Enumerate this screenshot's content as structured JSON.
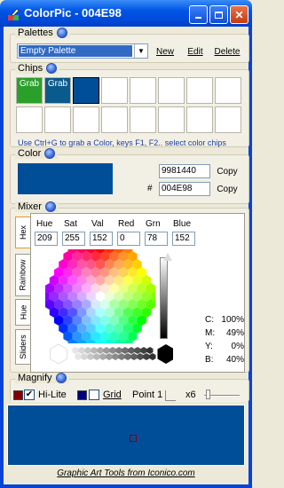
{
  "window": {
    "title": "ColorPic - 004E98"
  },
  "palettes": {
    "heading": "Palettes",
    "selected": "Empty Palette",
    "buttons": {
      "new": "New",
      "edit": "Edit",
      "delete": "Delete"
    }
  },
  "chips": {
    "heading": "Chips",
    "grab_label": "Grab",
    "hint": "Use Ctrl+G to grab a Color, keys F1, F2.. select color chips",
    "colors": [
      "#2aa02a",
      "#0b5a8c",
      "#004e98"
    ]
  },
  "color": {
    "heading": "Color",
    "decimal": "9981440",
    "hash": "#",
    "hex": "004E98",
    "copy_label": "Copy",
    "value": "#004e98"
  },
  "mixer": {
    "heading": "Mixer",
    "tabs": [
      "Hex",
      "Rainbow",
      "Hue",
      "Sliders"
    ],
    "labels": {
      "hue": "Hue",
      "sat": "Sat",
      "val": "Val",
      "red": "Red",
      "grn": "Grn",
      "blue": "Blue"
    },
    "values": {
      "hue": "209",
      "sat": "255",
      "val": "152",
      "red": "0",
      "grn": "78",
      "blue": "152"
    },
    "cmyk": [
      {
        "label": "C:",
        "value": "100%"
      },
      {
        "label": "M:",
        "value": "49%"
      },
      {
        "label": "Y:",
        "value": "0%"
      },
      {
        "label": "B:",
        "value": "40%"
      }
    ]
  },
  "magnify": {
    "heading": "Magnify",
    "hilite_label": "Hi-Lite",
    "grid_label": "Grid",
    "point_label": "Point 1",
    "zoom_label": "x6",
    "hilite_color": "#800000",
    "grid_color": "#000080"
  },
  "footer": {
    "text": "Graphic Art Tools from Iconico.com"
  }
}
